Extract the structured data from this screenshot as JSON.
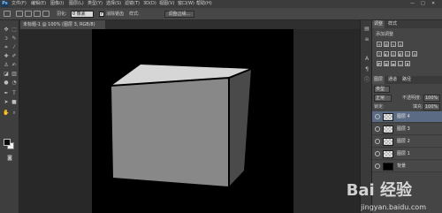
{
  "app": {
    "logo": "Ps"
  },
  "menu": [
    "文件(F)",
    "编辑(E)",
    "图像(I)",
    "图层(L)",
    "类型(Y)",
    "选择(S)",
    "滤镜(T)",
    "3D(D)",
    "视图(V)",
    "窗口(W)",
    "帮助(H)"
  ],
  "window_controls": {
    "minimize": "—",
    "maximize": "□",
    "close": "✕"
  },
  "options": {
    "feather_label": "羽化:",
    "feather_value": "0 像素",
    "antialias_label": "消除锯齿",
    "style_label": "样式:",
    "refine_button": "调整边缘..."
  },
  "document": {
    "tab_label": "未标题-1 @ 100% (图层 3, RGB/8)"
  },
  "colors": {
    "foreground": "#0a0a0a",
    "background": "#f4f4f4",
    "canvas": "#000000",
    "cube_front": "#888888",
    "cube_top": "#d6d6d6",
    "cube_side": "#4a4a4a",
    "selected_layer": "#5b6b84"
  },
  "tools": [
    "move-tool",
    "marquee-tool",
    "lasso-tool",
    "quick-select-tool",
    "crop-tool",
    "eyedropper-tool",
    "healing-tool",
    "brush-tool",
    "clone-stamp-tool",
    "history-brush-tool",
    "eraser-tool",
    "gradient-tool",
    "blur-tool",
    "dodge-tool",
    "pen-tool",
    "type-tool",
    "path-select-tool",
    "shape-tool",
    "hand-tool",
    "zoom-tool"
  ],
  "panel": {
    "tabs": [
      "调整",
      "样式"
    ],
    "add_adjustment": "添加调整",
    "layers_tabs": [
      "图层",
      "通道",
      "路径"
    ],
    "filter_kind": "类型",
    "blend_mode": "正常",
    "opacity_label": "不透明度:",
    "opacity_value": "100%",
    "lock_label": "锁定:",
    "fill_label": "填充:",
    "fill_value": "100%"
  },
  "layers": [
    {
      "name": "图层 4",
      "thumb": "check",
      "selected": true
    },
    {
      "name": "图层 3",
      "thumb": "check",
      "selected": false
    },
    {
      "name": "图层 2",
      "thumb": "check",
      "selected": false
    },
    {
      "name": "图层 1",
      "thumb": "check",
      "selected": false
    },
    {
      "name": "背景",
      "thumb": "black",
      "selected": false
    }
  ],
  "watermark": {
    "brand": "Bai 经验",
    "url": "jingyan.baidu.com"
  }
}
